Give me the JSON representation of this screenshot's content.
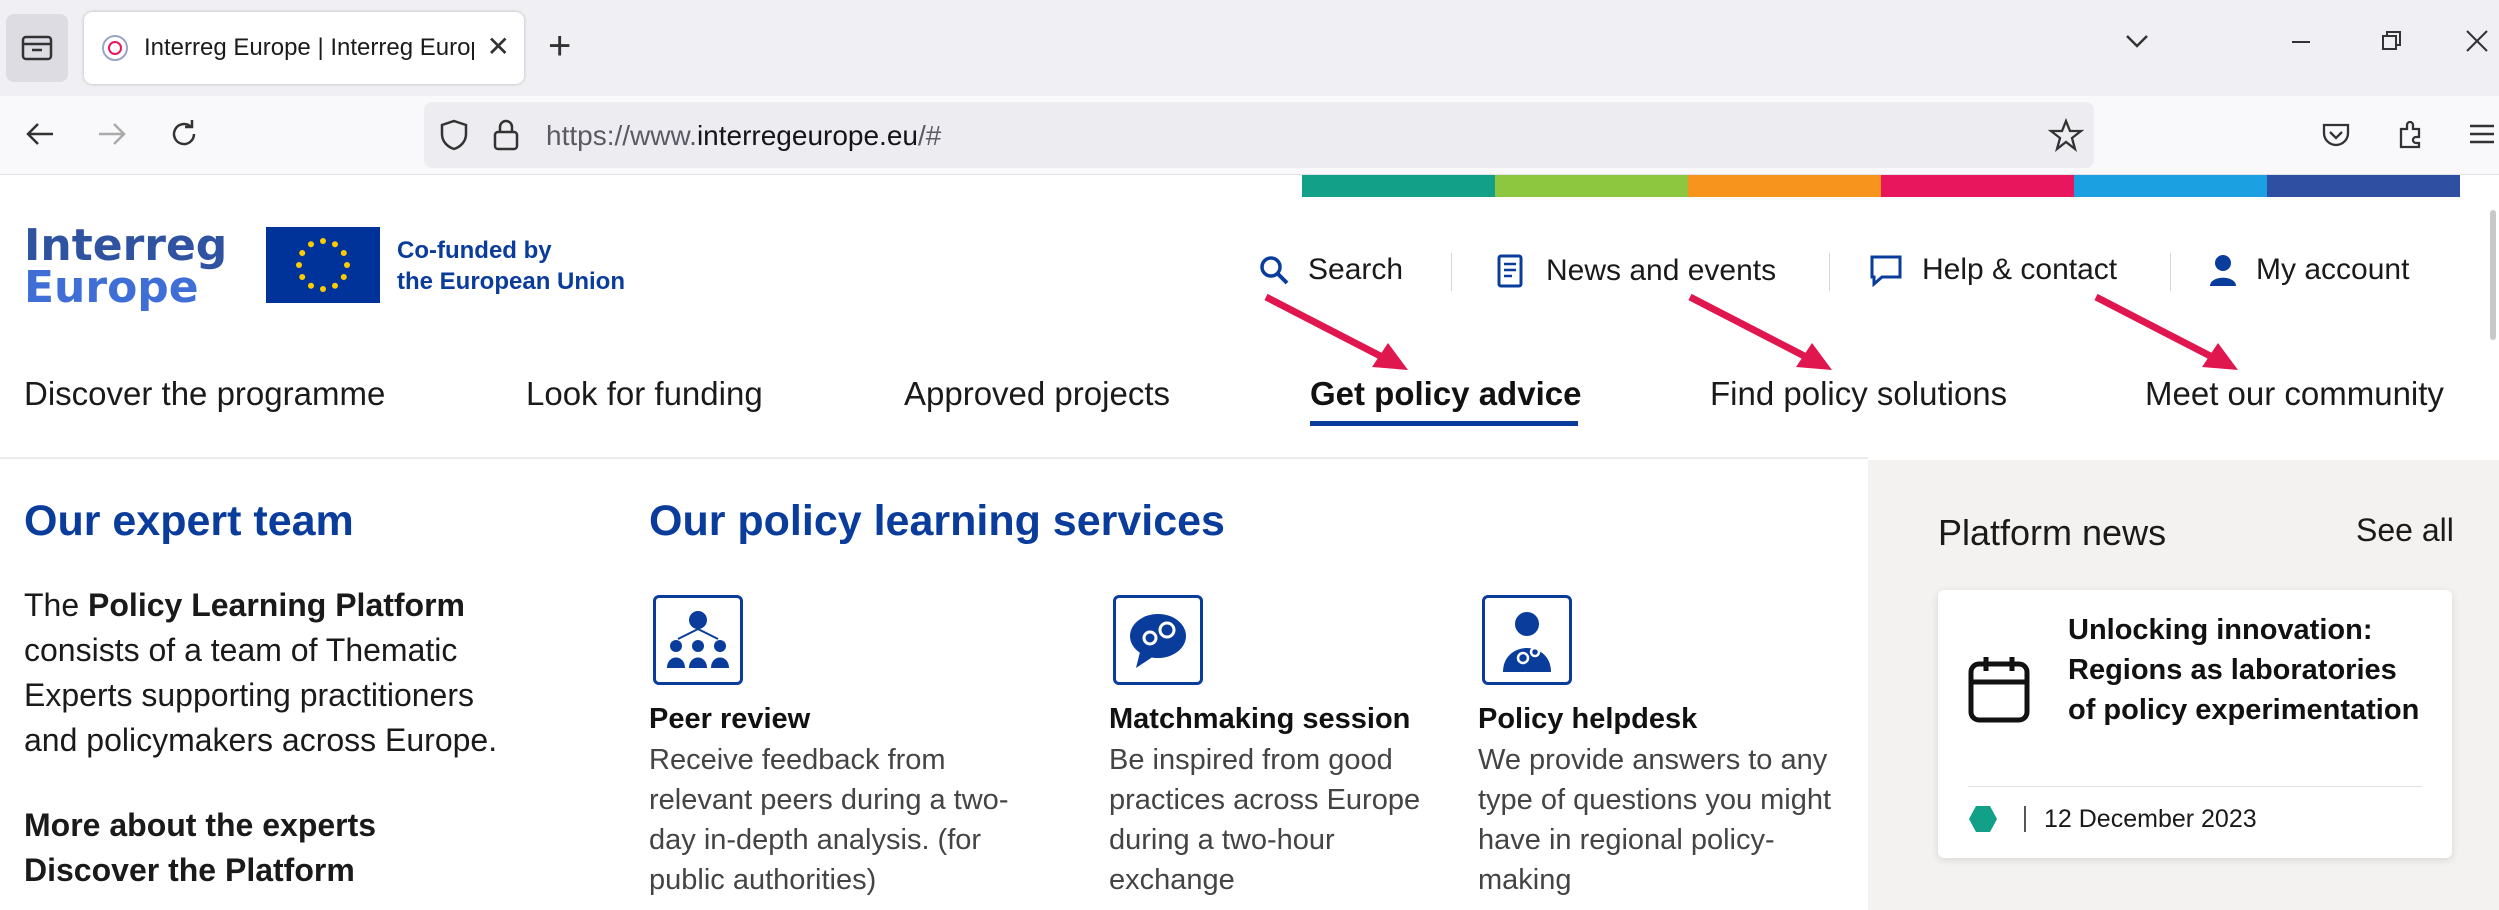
{
  "browser": {
    "tab_title": "Interreg Europe | Interreg Europe",
    "url_prefix": "https://www.",
    "url_host": "interregeurope.eu",
    "url_suffix": "/#"
  },
  "header": {
    "logo_line1": "Interreg",
    "logo_line2": "Europe",
    "cofunded_line1": "Co-funded by",
    "cofunded_line2": "the European Union",
    "colors": [
      "#12a089",
      "#8dc63f",
      "#f7941d",
      "#e8175d",
      "#1ba1e2",
      "#2f4fa3"
    ]
  },
  "utility_nav": [
    {
      "label": "Search",
      "icon": "search-icon"
    },
    {
      "label": "News and events",
      "icon": "newspaper-icon"
    },
    {
      "label": "Help & contact",
      "icon": "chat-icon"
    },
    {
      "label": "My account",
      "icon": "user-icon"
    }
  ],
  "main_nav": [
    {
      "label": "Discover the programme"
    },
    {
      "label": "Look for funding"
    },
    {
      "label": "Approved projects"
    },
    {
      "label": "Get policy advice",
      "active": true
    },
    {
      "label": "Find policy solutions"
    },
    {
      "label": "Meet our community"
    }
  ],
  "expert_team": {
    "heading": "Our expert team",
    "text_1": "The ",
    "text_bold": "Policy Learning Platform",
    "text_2": " consists of a team of Thematic Experts supporting practitioners and policymakers across Europe.",
    "link_1": "More about the experts",
    "link_2": "Discover the Platform"
  },
  "services": {
    "heading": "Our policy learning services",
    "items": [
      {
        "title": "Peer review",
        "desc": "Receive feedback from relevant peers during a two-day in-depth analysis. (for public authorities)",
        "icon": "people-network-icon"
      },
      {
        "title": "Matchmaking session",
        "desc": "Be inspired from good practices across Europe during a two-hour exchange",
        "icon": "chat-gears-icon"
      },
      {
        "title": "Policy helpdesk",
        "desc": "We provide answers to any type of questions you might have in regional policy-making",
        "icon": "person-gears-icon"
      }
    ]
  },
  "platform_news": {
    "heading": "Platform news",
    "see_all": "See all",
    "card_title": "Unlocking innovation: Regions as laboratories of policy experimentation",
    "card_date": "12 December 2023",
    "card_icon": "calendar-icon",
    "badge_color": "#12a089"
  }
}
